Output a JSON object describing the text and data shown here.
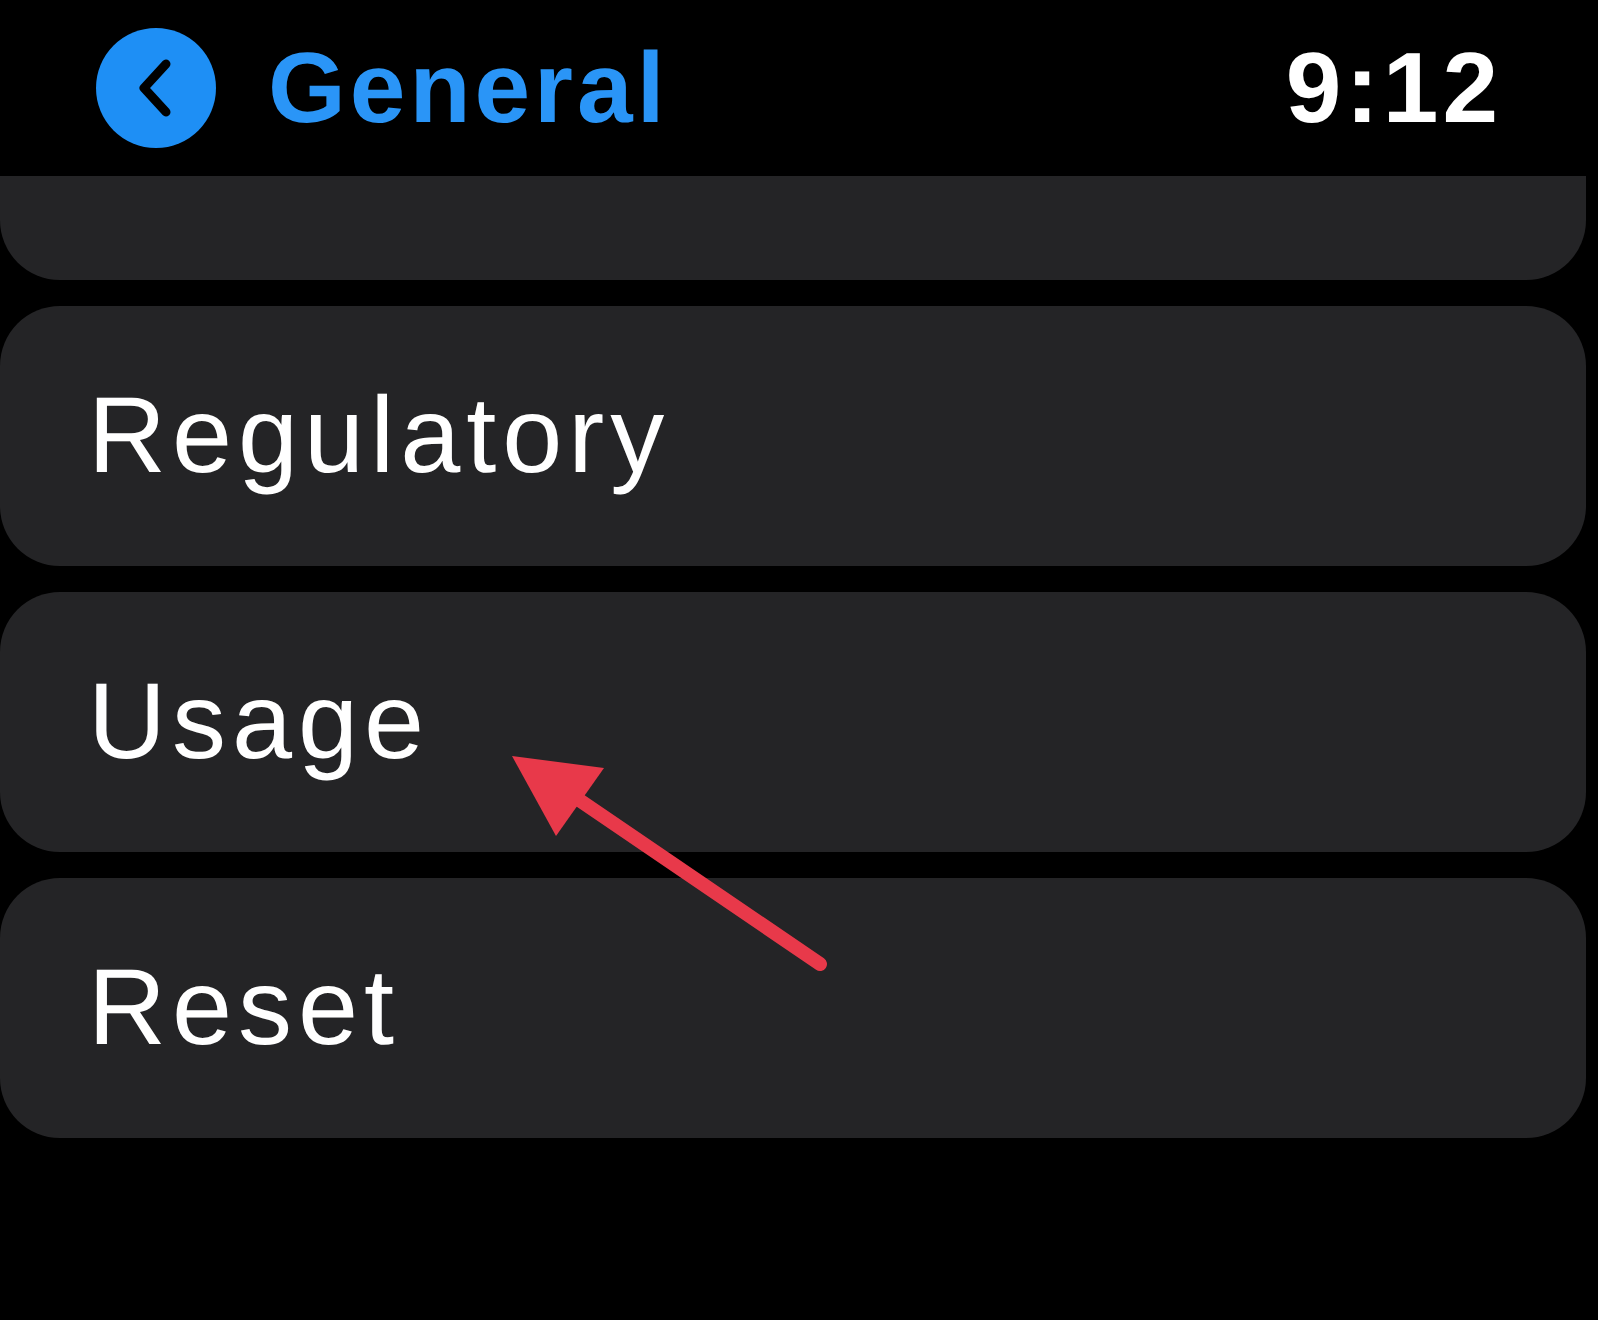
{
  "header": {
    "title": "General",
    "time": "9:12"
  },
  "items": [
    {
      "kind": "partial"
    },
    {
      "kind": "row",
      "label": "Regulatory"
    },
    {
      "kind": "row",
      "label": "Usage"
    },
    {
      "kind": "row",
      "label": "Reset"
    }
  ],
  "annotations": [
    {
      "kind": "arrow",
      "color": "#e8394a"
    }
  ]
}
